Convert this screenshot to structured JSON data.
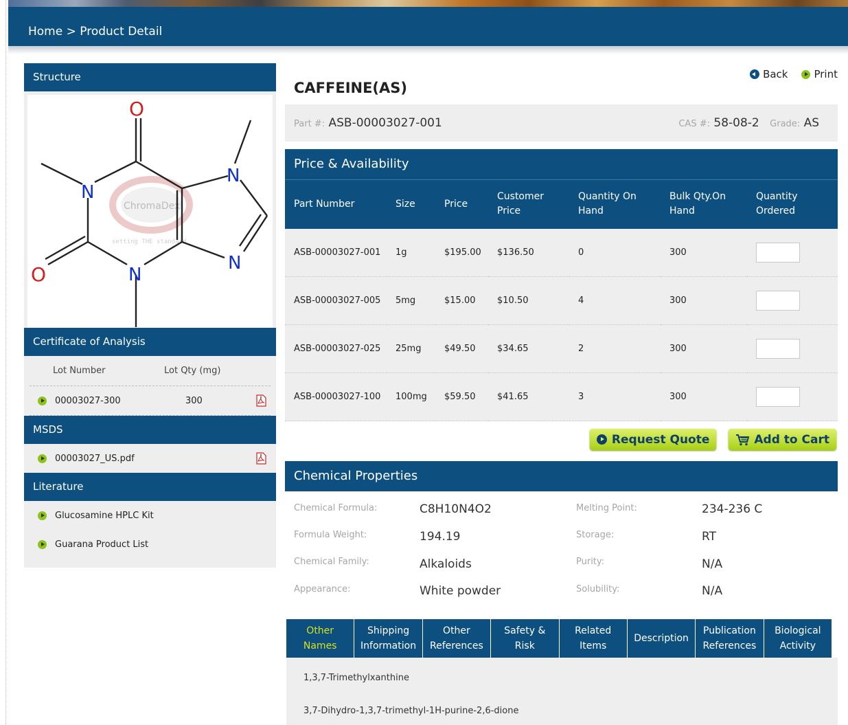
{
  "breadcrumb": "Home > Product Detail",
  "sidebar": {
    "structure_title": "Structure",
    "coa_title": "Certificate of Analysis",
    "coa_columns": [
      "Lot Number",
      "Lot Qty (mg)"
    ],
    "coa_rows": [
      {
        "lot": "00003027-300",
        "qty": "300"
      }
    ],
    "msds_title": "MSDS",
    "msds_file": "00003027_US.pdf",
    "literature_title": "Literature",
    "literature_items": [
      "Glucosamine HPLC Kit",
      "Guarana Product List"
    ],
    "watermark_text": "ChromaDex",
    "watermark_tagline": "setting THE standard",
    "atoms": [
      "O",
      "O",
      "N",
      "N",
      "N",
      "N"
    ]
  },
  "product": {
    "title": "CAFFEINE(AS)",
    "back_label": "Back",
    "print_label": "Print",
    "part_label": "Part #:",
    "part_number": "ASB-00003027-001",
    "cas_label": "CAS #:",
    "cas_number": "58-08-2",
    "grade_label": "Grade:",
    "grade": "AS"
  },
  "price": {
    "title": "Price & Availability",
    "columns": [
      "Part Number",
      "Size",
      "Price",
      "Customer Price",
      "Quantity On Hand",
      "Bulk Qty.On Hand",
      "Quantity Ordered"
    ],
    "rows": [
      {
        "part": "ASB-00003027-001",
        "size": "1g",
        "price": "$195.00",
        "customer": "$136.50",
        "onhand": "0",
        "bulk": "300"
      },
      {
        "part": "ASB-00003027-005",
        "size": "5mg",
        "price": "$15.00",
        "customer": "$10.50",
        "onhand": "4",
        "bulk": "300"
      },
      {
        "part": "ASB-00003027-025",
        "size": "25mg",
        "price": "$49.50",
        "customer": "$34.65",
        "onhand": "2",
        "bulk": "300"
      },
      {
        "part": "ASB-00003027-100",
        "size": "100mg",
        "price": "$59.50",
        "customer": "$41.65",
        "onhand": "3",
        "bulk": "300"
      }
    ],
    "request_quote_label": "Request Quote",
    "add_to_cart_label": "Add to Cart"
  },
  "chemical": {
    "title": "Chemical Properties",
    "props": [
      {
        "label": "Chemical Formula:",
        "value": "C8H10N4O2"
      },
      {
        "label": "Formula Weight:",
        "value": "194.19"
      },
      {
        "label": "Chemical Family:",
        "value": "Alkaloids"
      },
      {
        "label": "Appearance:",
        "value": "White powder"
      },
      {
        "label": "Melting Point:",
        "value": "234-236 C"
      },
      {
        "label": "Storage:",
        "value": "RT"
      },
      {
        "label": "Purity:",
        "value": "N/A"
      },
      {
        "label": "Solubility:",
        "value": "N/A"
      }
    ]
  },
  "tabs": {
    "labels": [
      [
        "Other",
        "Names"
      ],
      [
        "Shipping",
        "Information"
      ],
      [
        "Other",
        "References"
      ],
      [
        "Safety &",
        "Risk"
      ],
      [
        "Related",
        "Items"
      ],
      [
        "Description",
        ""
      ],
      [
        "Publication",
        "References"
      ],
      [
        "Biological",
        "Activity"
      ]
    ],
    "active_index": 0,
    "other_names": [
      "1,3,7-Trimethylxanthine",
      "3,7-Dihydro-1,3,7-trimethyl-1H-purine-2,6-dione"
    ]
  },
  "colors": {
    "navy": "#0d4f7e",
    "panel": "#eeeeee",
    "lime": "#a8d017",
    "active_tab": "#d7e21a",
    "atom_O": "#d12020",
    "atom_N": "#1030d0"
  }
}
